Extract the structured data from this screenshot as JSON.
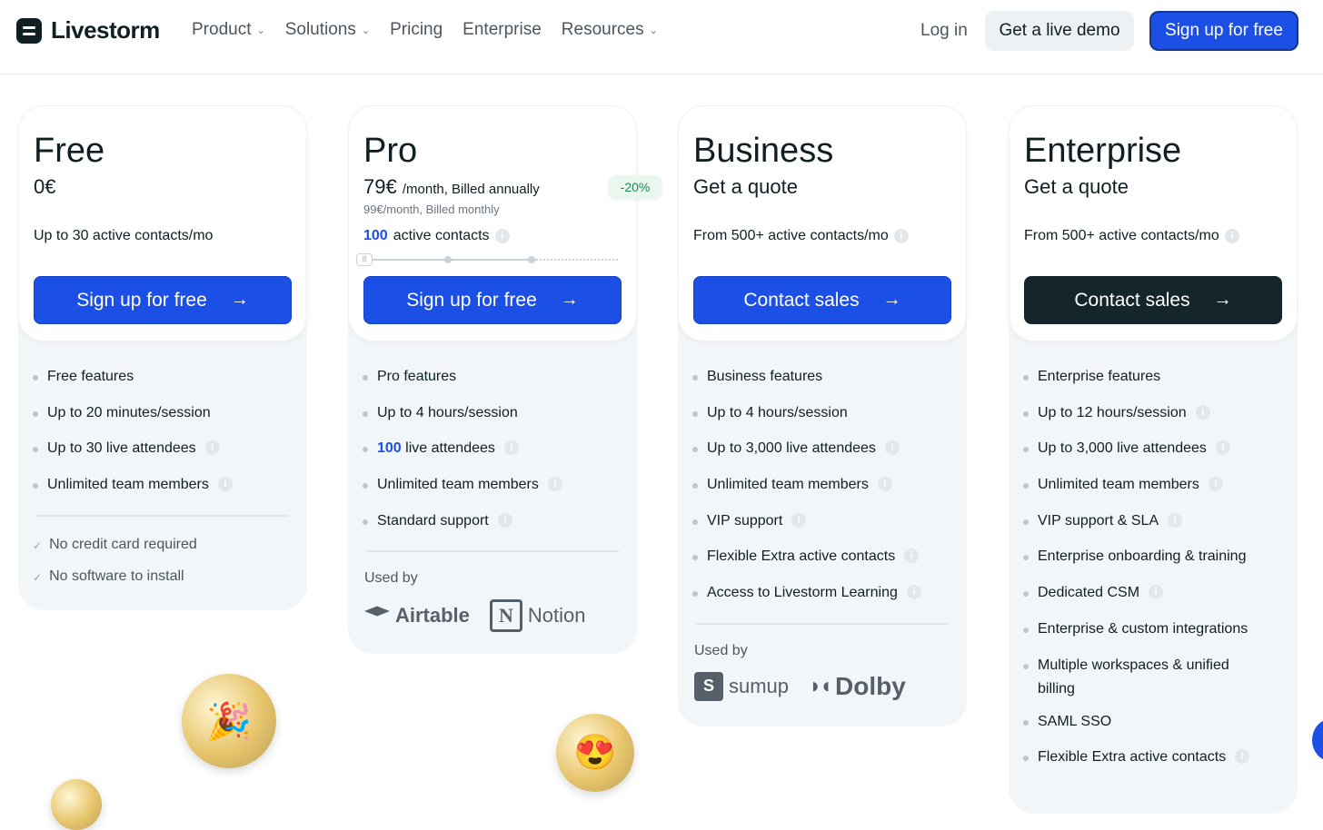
{
  "nav": {
    "brand": "Livestorm",
    "menu": [
      "Product",
      "Solutions",
      "Pricing",
      "Enterprise",
      "Resources"
    ],
    "login": "Log in",
    "demo": "Get a live demo",
    "signup": "Sign up for free"
  },
  "plans": {
    "free": {
      "name": "Free",
      "price": "0€",
      "contacts": "Up to 30 active contacts/mo",
      "cta": "Sign up for free",
      "features": [
        "Free features",
        "Up to 20 minutes/session",
        "Up to 30 live attendees",
        "Unlimited team members"
      ],
      "checks": [
        "No credit card required",
        "No software to install"
      ]
    },
    "pro": {
      "name": "Pro",
      "price": "79€",
      "price_suffix": "/month, Billed annually",
      "subprice": "99€/month, Billed monthly",
      "badge": "-20%",
      "contacts_value": "100",
      "contacts_suffix": "active contacts",
      "cta": "Sign up for free",
      "features": [
        "Pro features",
        "Up to 4 hours/session",
        "live attendees",
        "Unlimited team members",
        "Standard support"
      ],
      "attendees_value": "100",
      "used_by": "Used by",
      "logos": [
        "Airtable",
        "Notion"
      ]
    },
    "business": {
      "name": "Business",
      "price": "Get a quote",
      "contacts": "From 500+ active contacts/mo",
      "cta": "Contact sales",
      "features": [
        "Business features",
        "Up to 4 hours/session",
        "Up to 3,000 live attendees",
        "Unlimited team members",
        "VIP support",
        "Flexible Extra active contacts",
        "Access to Livestorm Learning"
      ],
      "used_by": "Used by",
      "logos": [
        "sumup",
        "Dolby"
      ]
    },
    "enterprise": {
      "name": "Enterprise",
      "price": "Get a quote",
      "contacts": "From 500+ active contacts/mo",
      "cta": "Contact sales",
      "features": [
        "Enterprise features",
        "Up to 12 hours/session",
        "Up to 3,000 live attendees",
        "Unlimited team members",
        "VIP support & SLA",
        "Enterprise onboarding & training",
        "Dedicated CSM",
        "Enterprise & custom integrations",
        "Multiple workspaces & unified billing",
        "SAML SSO",
        "Flexible Extra active contacts"
      ]
    }
  },
  "icons": {
    "arrow": "arrow-right-icon",
    "info": "info-icon",
    "check": "check-icon"
  },
  "colors": {
    "primary": "#1c4fe6",
    "dark_cta": "#14262b",
    "badge_green": "#1f8a55"
  }
}
